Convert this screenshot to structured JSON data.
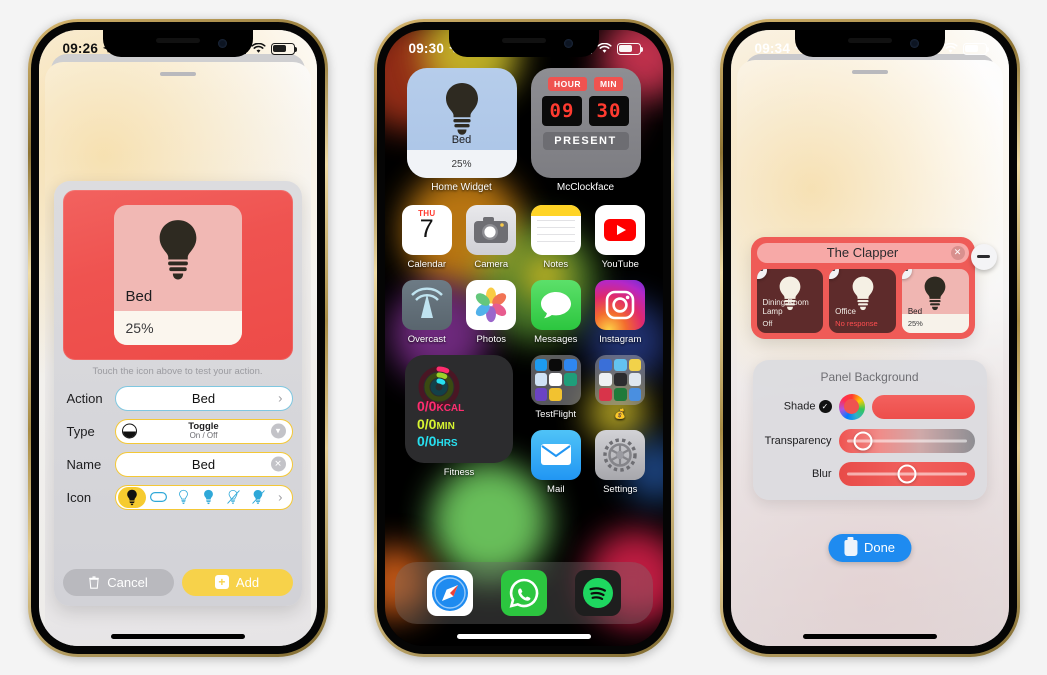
{
  "page": {
    "background_color": "#f4f4f4"
  },
  "phone1": {
    "status": {
      "time": "09:26",
      "location_icon": "location-arrow",
      "signal": "cellular-bars",
      "wifi": "wifi-icon",
      "battery": "battery-icon"
    },
    "preview": {
      "name": "Bed",
      "percent": "25%",
      "icon": "lightbulb-icon",
      "tile_color": "#ef5350"
    },
    "hint": "Touch the icon above to test your action.",
    "fields": [
      {
        "label": "Action",
        "value": "Bed",
        "accessory": "chevron-right",
        "border": "#7fc7e0"
      },
      {
        "label": "Type",
        "value": "Toggle",
        "subvalue": "On / Off",
        "accessory": "chevron-down-circle",
        "border": "#f4c836"
      },
      {
        "label": "Name",
        "value": "Bed",
        "accessory": "clear-circle",
        "border": "#f4c836"
      },
      {
        "label": "Icon",
        "value": "",
        "accessory": "chevron-right",
        "border": "#f4c836"
      }
    ],
    "icon_choices": [
      "lightbulb-filled-icon",
      "capsule-icon",
      "lightbulb-outline-icon",
      "lightbulb-filled-blue-icon",
      "lightbulb-slash-outline-icon",
      "lightbulb-slash-filled-icon"
    ],
    "buttons": {
      "cancel_label": "Cancel",
      "cancel_icon": "trash-icon",
      "add_label": "Add",
      "add_icon": "plus-square-icon"
    }
  },
  "phone2": {
    "status": {
      "time": "09:30"
    },
    "widgets": [
      {
        "name": "Home Widget",
        "type": "home-widget",
        "device": "Bed",
        "percent": "25%",
        "icon": "lightbulb-icon"
      },
      {
        "name": "McClockface",
        "type": "clock-widget",
        "hour_tag": "HOUR",
        "min_tag": "MIN",
        "hour": "09",
        "min": "30",
        "button": "PRESENT"
      }
    ],
    "apps_row1": [
      {
        "name": "Calendar",
        "icon": "calendar-icon",
        "weekday": "THU",
        "day": "7"
      },
      {
        "name": "Camera",
        "icon": "camera-icon"
      },
      {
        "name": "Notes",
        "icon": "notes-icon"
      },
      {
        "name": "YouTube",
        "icon": "youtube-icon"
      }
    ],
    "apps_row2": [
      {
        "name": "Overcast",
        "icon": "overcast-icon"
      },
      {
        "name": "Photos",
        "icon": "photos-icon"
      },
      {
        "name": "Messages",
        "icon": "messages-icon"
      },
      {
        "name": "Instagram",
        "icon": "instagram-icon"
      }
    ],
    "fitness_widget": {
      "name": "Fitness",
      "icon": "activity-rings-icon",
      "lines": [
        {
          "value": "0/0",
          "unit": "KCAL",
          "color": "#ff2d6f"
        },
        {
          "value": "0/0",
          "unit": "MIN",
          "color": "#d7f531"
        },
        {
          "value": "0/0",
          "unit": "HRS",
          "color": "#27e0f0"
        }
      ]
    },
    "folders": [
      {
        "name": "TestFlight",
        "icon": "folder-icon"
      },
      {
        "name": "💰",
        "icon": "folder-icon"
      }
    ],
    "apps_row3": [
      {
        "name": "Mail",
        "icon": "mail-icon"
      },
      {
        "name": "Settings",
        "icon": "settings-gear-icon"
      }
    ],
    "dock": [
      {
        "name": "Safari",
        "icon": "safari-compass-icon"
      },
      {
        "name": "WhatsApp",
        "icon": "whatsapp-icon"
      },
      {
        "name": "Spotify",
        "icon": "spotify-icon"
      }
    ]
  },
  "phone3": {
    "status": {
      "time": "09:34"
    },
    "clapper": {
      "title": "The Clapper",
      "close_icon": "close-circle-icon",
      "expand_icon": "minimize-icon",
      "remove_icon": "minus-circle-icon",
      "items": [
        {
          "name": "Dining Room Lamp",
          "status": "Off",
          "state": "off",
          "icon": "lightbulb-icon"
        },
        {
          "name": "Office",
          "status": "No response",
          "state": "no-response",
          "icon": "lightbulb-icon"
        },
        {
          "name": "Bed",
          "status": "25%",
          "state": "on",
          "icon": "lightbulb-icon"
        }
      ]
    },
    "panel": {
      "title": "Panel Background",
      "rows": [
        {
          "label": "Shade",
          "control": "color-swatch",
          "checked": true,
          "color": "#ef5350"
        },
        {
          "label": "Transparency",
          "control": "slider",
          "value_pct": 16
        },
        {
          "label": "Blur",
          "control": "slider",
          "value_pct": 50
        }
      ]
    },
    "done_button": {
      "label": "Done",
      "icon": "save-icon",
      "color": "#1e8bf0"
    }
  }
}
